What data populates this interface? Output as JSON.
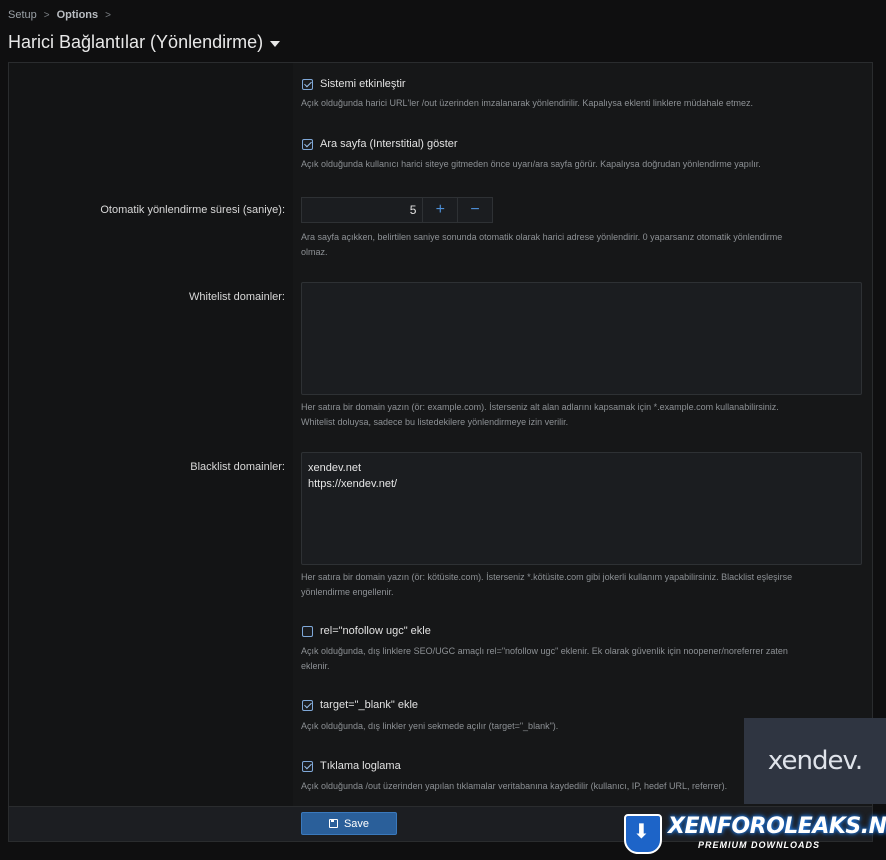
{
  "breadcrumb": {
    "items": [
      "Setup",
      "Options"
    ]
  },
  "page": {
    "title": "Harici Bağlantılar (Yönlendirme)"
  },
  "options": {
    "enable": {
      "label": "Sistemi etkinleştir",
      "checked": true,
      "hint": "Açık olduğunda harici URL'ler /out üzerinden imzalanarak yönlendirilir. Kapalıysa eklenti linklere müdahale etmez."
    },
    "interstitial": {
      "label": "Ara sayfa (Interstitial) göster",
      "checked": true,
      "hint": "Açık olduğunda kullanıcı harici siteye gitmeden önce uyarı/ara sayfa görür. Kapalıysa doğrudan yönlendirme yapılır."
    },
    "delay": {
      "label": "Otomatik yönlendirme süresi (saniye):",
      "value": "5",
      "plus": "+",
      "minus": "−",
      "hint1": "Ara sayfa açıkken, belirtilen saniye sonunda otomatik olarak harici adrese yönlendirir. 0 yaparsanız otomatik yönlendirme",
      "hint2": "olmaz."
    },
    "whitelist": {
      "label": "Whitelist domainler:",
      "value": "",
      "hint1": "Her satıra bir domain yazın (ör: example.com). İsterseniz alt alan adlarını kapsamak için *.example.com kullanabilirsiniz.",
      "hint2": "Whitelist doluysa, sadece bu listedekilere yönlendirmeye izin verilir."
    },
    "blacklist": {
      "label": "Blacklist domainler:",
      "value": "xendev.net\nhttps://xendev.net/",
      "hint1": "Her satıra bir domain yazın (ör: kötüsite.com). İsterseniz *.kötüsite.com gibi jokerli kullanım yapabilirsiniz. Blacklist eşleşirse",
      "hint2": "yönlendirme engellenir."
    },
    "nofollow": {
      "label": "rel=\"nofollow ugc\" ekle",
      "checked": false,
      "hint1": "Açık olduğunda, dış linklere SEO/UGC amaçlı rel=\"nofollow ugc\" eklenir. Ek olarak güvenlik için noopener/noreferrer zaten",
      "hint2": "eklenir."
    },
    "blank": {
      "label": "target=\"_blank\" ekle",
      "checked": true,
      "hint": "Açık olduğunda, dış linkler yeni sekmede açılır (target=\"_blank\")."
    },
    "logging": {
      "label": "Tıklama loglama",
      "checked": true,
      "hint": "Açık olduğunda /out üzerinden yapılan tıklamalar veritabanına kaydedilir (kullanıcı, IP, hedef URL, referrer)."
    }
  },
  "footer": {
    "save_label": "Save"
  },
  "watermarks": {
    "xendev": "xendev.",
    "xfl_name": "XENFOROLEAKS.NET",
    "xfl_sub": "PREMIUM DOWNLOADS"
  }
}
